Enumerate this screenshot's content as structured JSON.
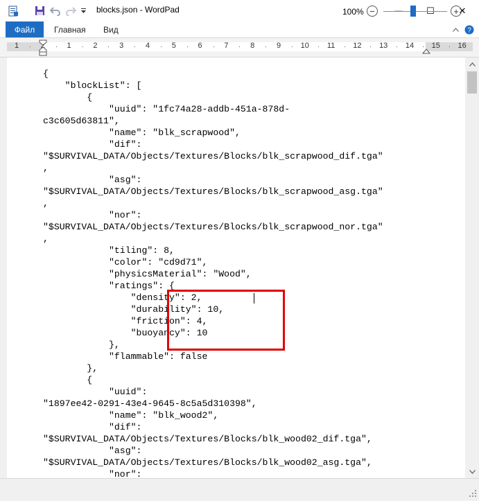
{
  "window": {
    "title": "blocks.json - WordPad",
    "minimize_glyph": "—",
    "maximize_glyph": "☐",
    "close_glyph": "✕"
  },
  "quick_access": {
    "icons": [
      "wordpad-app-icon",
      "save-icon",
      "undo-icon",
      "redo-icon",
      "customize-dropdown-icon"
    ]
  },
  "ribbon": {
    "tabs": [
      "Файл",
      "Главная",
      "Вид"
    ],
    "collapse_glyph": "⌃",
    "help_glyph": "?"
  },
  "ruler": {
    "numbers": [
      "1",
      "2",
      "1",
      "2",
      "3",
      "4",
      "5",
      "6",
      "7",
      "8",
      "9",
      "10",
      "11",
      "12",
      "13",
      "14",
      "15",
      "16"
    ]
  },
  "document": {
    "lines": [
      "{",
      "    \"blockList\": [",
      "        {",
      "            \"uuid\": \"1fc74a28-addb-451a-878d-",
      "c3c605d63811\",",
      "            \"name\": \"blk_scrapwood\",",
      "            \"dif\":",
      "\"$SURVIVAL_DATA/Objects/Textures/Blocks/blk_scrapwood_dif.tga\"",
      ",",
      "            \"asg\":",
      "\"$SURVIVAL_DATA/Objects/Textures/Blocks/blk_scrapwood_asg.tga\"",
      ",",
      "            \"nor\":",
      "\"$SURVIVAL_DATA/Objects/Textures/Blocks/blk_scrapwood_nor.tga\"",
      ",",
      "            \"tiling\": 8,",
      "            \"color\": \"cd9d71\",",
      "            \"physicsMaterial\": \"Wood\",",
      "            \"ratings\": {",
      "                \"density\": 2,",
      "                \"durability\": 10,",
      "                \"friction\": 4,",
      "                \"buoyancy\": 10",
      "            },",
      "            \"flammable\": false",
      "        },",
      "        {",
      "            \"uuid\":",
      "\"1897ee42-0291-43e4-9645-8c5a5d310398\",",
      "            \"name\": \"blk_wood2\",",
      "            \"dif\":",
      "\"$SURVIVAL_DATA/Objects/Textures/Blocks/blk_wood02_dif.tga\",",
      "            \"asg\":",
      "\"$SURVIVAL_DATA/Objects/Textures/Blocks/blk_wood02_asg.tga\",",
      "            \"nor\":"
    ]
  },
  "status": {
    "zoom": "100%",
    "zoom_out_glyph": "−",
    "zoom_in_glyph": "+",
    "zoom_level_fraction": 0.5
  },
  "colors": {
    "accent": "#1e6dc3",
    "highlight_border": "#e00000"
  }
}
